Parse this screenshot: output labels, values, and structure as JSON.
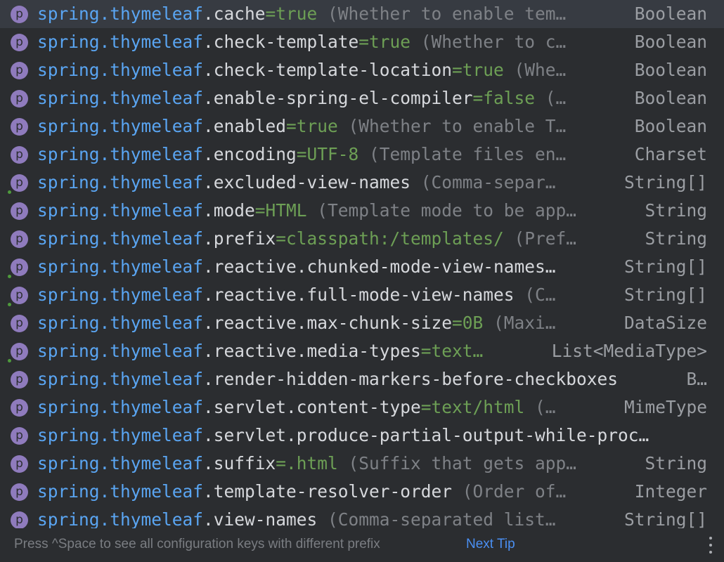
{
  "colors": {
    "background": "#2b2d30",
    "selected_row": "#373b42",
    "prefix": "#5aa5f2",
    "key": "#d6d8dc",
    "value": "#6d9f55",
    "description": "#7e8186",
    "type": "#9b9ea3",
    "icon": "#8f7bbd",
    "link": "#4a8ff2"
  },
  "icon_glyph": "p",
  "icon_name": "property-icon",
  "prefix": "spring.thymeleaf",
  "items": [
    {
      "key": ".cache",
      "value": "=true",
      "desc": " (Whether to enable tem…",
      "type": "Boolean",
      "modified": false,
      "selected": true
    },
    {
      "key": ".check-template",
      "value": "=true",
      "desc": " (Whether to c…",
      "type": "Boolean",
      "modified": false
    },
    {
      "key": ".check-template-location",
      "value": "=true",
      "desc": " (Whe…",
      "type": "Boolean",
      "modified": false
    },
    {
      "key": ".enable-spring-el-compiler",
      "value": "=false",
      "desc": " (…",
      "type": "Boolean",
      "modified": false
    },
    {
      "key": ".enabled",
      "value": "=true",
      "desc": " (Whether to enable T…",
      "type": "Boolean",
      "modified": false
    },
    {
      "key": ".encoding",
      "value": "=UTF-8",
      "desc": " (Template files en…",
      "type": "Charset",
      "modified": false
    },
    {
      "key": ".excluded-view-names",
      "value": "",
      "desc": " (Comma-separ…",
      "type": "String[]",
      "modified": true
    },
    {
      "key": ".mode",
      "value": "=HTML",
      "desc": " (Template mode to be app…",
      "type": "String",
      "modified": false
    },
    {
      "key": ".prefix",
      "value": "=classpath:/templates/",
      "desc": " (Pref…",
      "type": "String",
      "modified": false
    },
    {
      "key": ".reactive.chunked-mode-view-names…",
      "value": "",
      "desc": "",
      "type": "String[]",
      "modified": true
    },
    {
      "key": ".reactive.full-mode-view-names",
      "value": "",
      "desc": " (C…",
      "type": "String[]",
      "modified": true
    },
    {
      "key": ".reactive.max-chunk-size",
      "value": "=0B",
      "desc": " (Maxi…",
      "type": "DataSize",
      "modified": false
    },
    {
      "key": ".reactive.media-types",
      "value": "=text…",
      "desc": "",
      "type": "List<MediaType>",
      "modified": true
    },
    {
      "key": ".render-hidden-markers-before-checkboxes",
      "value": "",
      "desc": "",
      "type": "B…",
      "modified": false
    },
    {
      "key": ".servlet.content-type",
      "value": "=text/html",
      "desc": " (…",
      "type": "MimeType",
      "modified": false
    },
    {
      "key": ".servlet.produce-partial-output-while-proc…",
      "value": "",
      "desc": "",
      "type": "",
      "modified": false
    },
    {
      "key": ".suffix",
      "value": "=.html",
      "desc": " (Suffix that gets app…",
      "type": "String",
      "modified": false
    },
    {
      "key": ".template-resolver-order",
      "value": "",
      "desc": " (Order of…",
      "type": "Integer",
      "modified": false
    },
    {
      "key": ".view-names",
      "value": "",
      "desc": " (Comma-separated list…",
      "type": "String[]",
      "modified": false
    }
  ],
  "footer": {
    "hint": "Press ^Space to see all configuration keys with different prefix",
    "link": "Next Tip",
    "more_icon": "more-vertical-icon"
  }
}
